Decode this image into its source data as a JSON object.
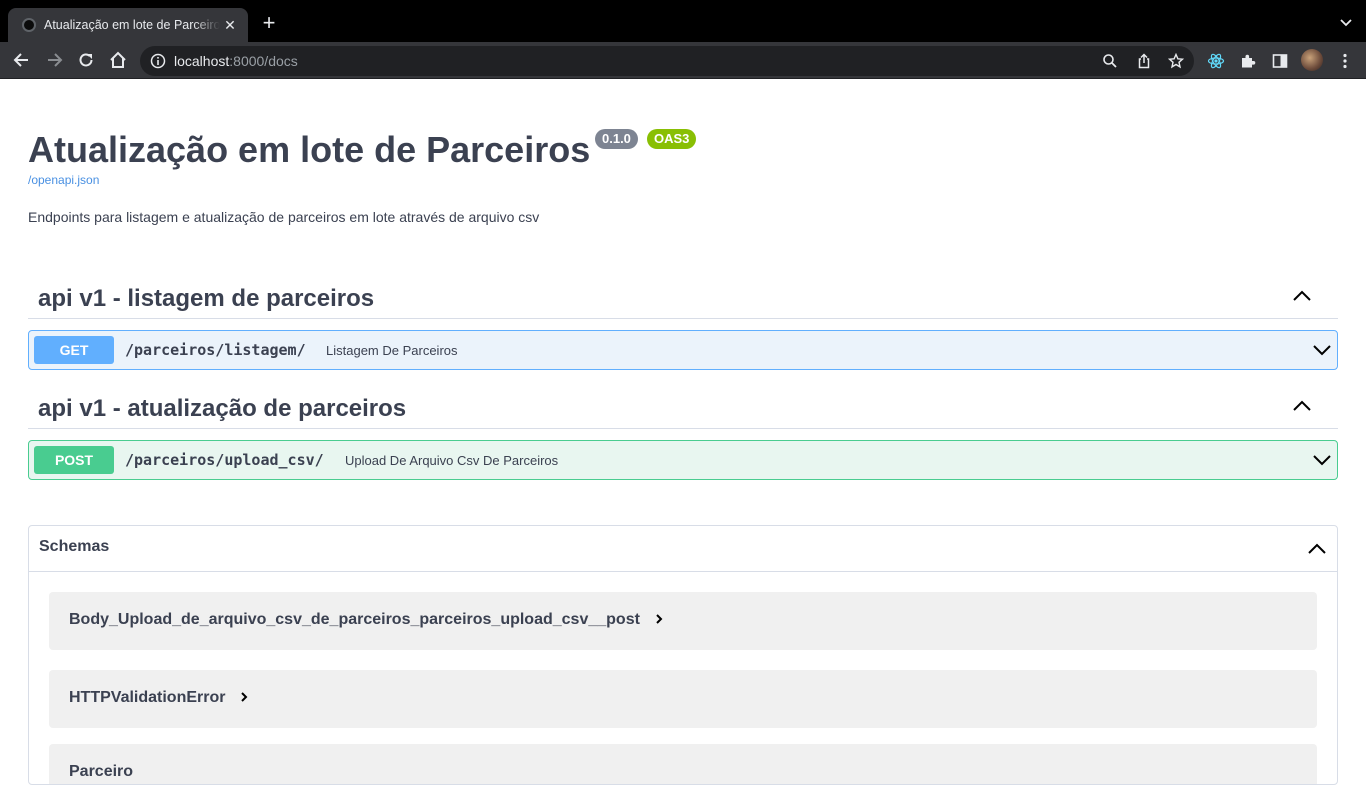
{
  "browser": {
    "tab_title": "Atualização em lote de Parceiros",
    "tab_close": "✕",
    "new_tab": "+",
    "url_host": "localhost",
    "url_rest": ":8000/docs"
  },
  "page": {
    "title": "Atualização em lote de Parceiros",
    "version_badge": "0.1.0",
    "oas_badge": "OAS3",
    "openapi_link": "/openapi.json",
    "description": "Endpoints para listagem e atualização de parceiros em lote através de arquivo csv",
    "tags": [
      {
        "name": "api v1 - listagem de parceiros",
        "operations": [
          {
            "method": "GET",
            "path": "/parceiros/listagem/",
            "summary": "Listagem De Parceiros"
          }
        ]
      },
      {
        "name": "api v1 - atualização de parceiros",
        "operations": [
          {
            "method": "POST",
            "path": "/parceiros/upload_csv/",
            "summary": "Upload De Arquivo Csv De Parceiros"
          }
        ]
      }
    ],
    "schemas": {
      "title": "Schemas",
      "models": [
        "Body_Upload_de_arquivo_csv_de_parceiros_parceiros_upload_csv__post",
        "HTTPValidationError",
        "Parceiro"
      ]
    }
  },
  "colors": {
    "get": "#61affe",
    "post": "#49cc90",
    "text": "#3b4151",
    "badge_version": "#7d8492",
    "badge_oas": "#89bf04"
  }
}
